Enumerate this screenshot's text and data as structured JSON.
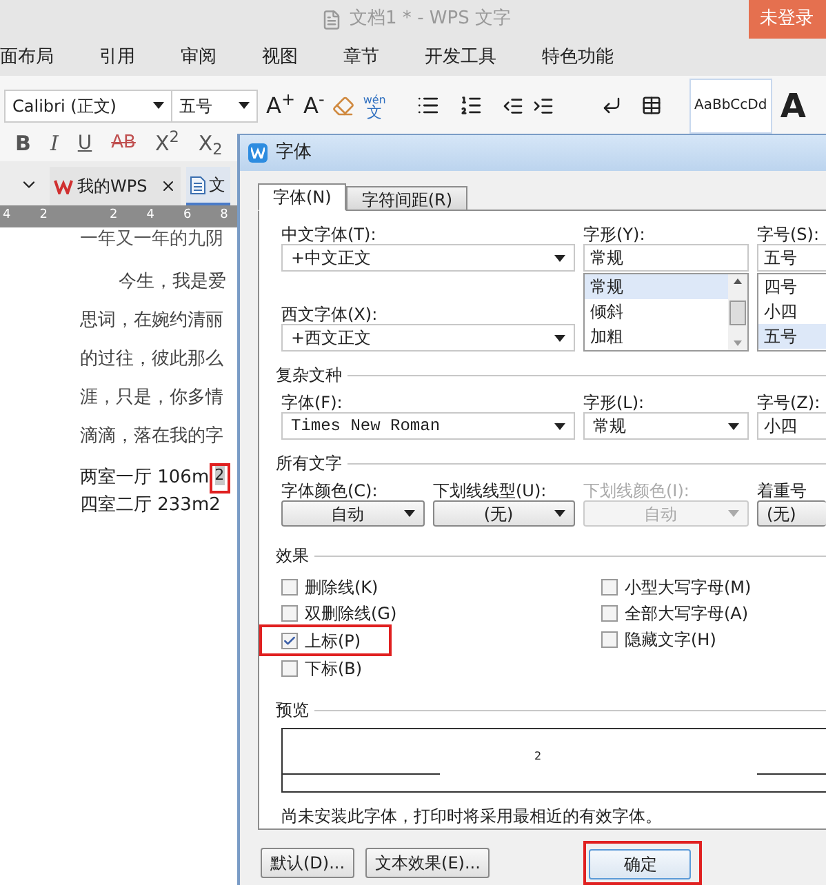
{
  "window": {
    "title": "文档1 * - WPS 文字",
    "login_button": "未登录"
  },
  "menu": [
    "面布局",
    "引用",
    "审阅",
    "视图",
    "章节",
    "开发工具",
    "特色功能"
  ],
  "toolbar": {
    "font": "Calibri (正文)",
    "size": "五号",
    "grow": "A$^{+}$",
    "shrink": "A$^{-}$",
    "pinyin_top": "wén",
    "pinyin_bottom": "文",
    "bold": "B",
    "italic": "I",
    "underline": "U",
    "strike": "AB",
    "superscript": "X$^{2}$",
    "subscript": "X$_{2}$",
    "style_preview": "AaBbCcDd",
    "style_big": "A"
  },
  "doc_tabs": [
    {
      "label": "我的WPS",
      "selected": false,
      "closable": true
    },
    {
      "label": "文",
      "selected": true,
      "closable": false
    }
  ],
  "ruler": [
    "4",
    "2",
    "2",
    "4",
    "6",
    "8"
  ],
  "document": {
    "lines": [
      "一年又一年的九阴",
      "今生，我是爱",
      "思词，在婉约清丽",
      "的过往，彼此那么",
      "涯，只是，你多情",
      "滴滴，落在我的字"
    ],
    "rooms": [
      {
        "text": "两室一厅 106m",
        "unit_mark": "2",
        "superscript": true,
        "highlighted": true
      },
      {
        "text": "四室二厅 233m",
        "unit_mark": "2",
        "superscript": false,
        "highlighted": false
      }
    ]
  },
  "dialog": {
    "title": "字体",
    "tabs": [
      {
        "label": "字体(N)",
        "selected": true
      },
      {
        "label": "字符间距(R)",
        "selected": false
      }
    ],
    "chinese_font": {
      "label": "中文字体(T):",
      "value": "+中文正文"
    },
    "western_font": {
      "label": "西文字体(X):",
      "value": "+西文正文"
    },
    "style": {
      "label": "字形(Y):",
      "value": "常规",
      "options": [
        {
          "label": "常规",
          "selected": true
        },
        {
          "label": "倾斜",
          "selected": false
        },
        {
          "label": "加粗",
          "selected": false
        }
      ]
    },
    "size": {
      "label": "字号(S):",
      "value": "五号",
      "options": [
        {
          "label": "四号",
          "selected": false
        },
        {
          "label": "小四",
          "selected": false
        },
        {
          "label": "五号",
          "selected": true
        }
      ]
    },
    "complex": {
      "heading": "复杂文种",
      "font_label": "字体(F):",
      "font_value": "Times New Roman",
      "style_label": "字形(L):",
      "style_value": "常规",
      "size_label": "字号(Z):",
      "size_value": "小四"
    },
    "all_text": {
      "heading": "所有文字",
      "fields": [
        {
          "label": "字体颜色(C):",
          "value": "自动",
          "disabled": false
        },
        {
          "label": "下划线线型(U):",
          "value": "(无)",
          "disabled": false
        },
        {
          "label": "下划线颜色(I):",
          "value": "自动",
          "disabled": true
        },
        {
          "label": "着重号",
          "value": "(无)",
          "disabled": false
        }
      ]
    },
    "effects": {
      "heading": "效果",
      "left": [
        {
          "label": "删除线(K)",
          "checked": false,
          "highlighted": false
        },
        {
          "label": "双删除线(G)",
          "checked": false,
          "highlighted": false
        },
        {
          "label": "上标(P)",
          "checked": true,
          "highlighted": true
        },
        {
          "label": "下标(B)",
          "checked": false,
          "highlighted": false
        }
      ],
      "right": [
        {
          "label": "小型大写字母(M)",
          "checked": false
        },
        {
          "label": "全部大写字母(A)",
          "checked": false
        },
        {
          "label": "隐藏文字(H)",
          "checked": false
        }
      ]
    },
    "preview": {
      "heading": "预览",
      "sample": "2"
    },
    "note": "尚未安装此字体，打印时将采用最相近的有效字体。",
    "buttons": [
      {
        "label": "默认(D)...",
        "kind": "secondary",
        "highlighted": false
      },
      {
        "label": "文本效果(E)...",
        "kind": "secondary",
        "highlighted": false
      },
      {
        "label": "确定",
        "kind": "primary",
        "highlighted": true
      }
    ]
  }
}
